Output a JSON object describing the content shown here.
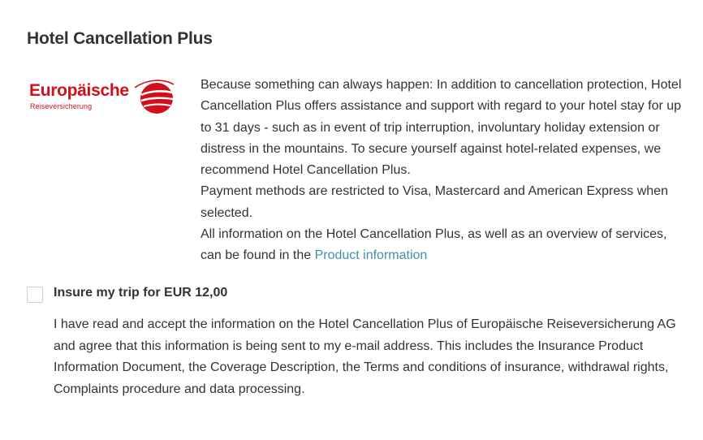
{
  "section": {
    "title": "Hotel Cancellation Plus"
  },
  "logo": {
    "brand": "Europäische",
    "sub": "Reiseversicherung",
    "color": "#d0111b",
    "icon": "globe-ball-icon"
  },
  "description": {
    "para1": "Because something can always happen: In addition to cancellation protection, Hotel Cancellation Plus offers assistance and support with regard to your hotel stay for up to 31 days - such as in event of trip interruption, involuntary holiday extension or distress in the mountains. To secure yourself against hotel-related expenses, we recommend Hotel Cancellation Plus.",
    "para2": "Payment methods are restricted to Visa, Mastercard and American Express when selected.",
    "para3_prefix": "All information on the Hotel Cancellation Plus, as well as an overview of services, can be found in the ",
    "product_link": "Product information",
    "link_color": "#3b93a8"
  },
  "insure": {
    "label": "Insure my trip for EUR 12,00",
    "checked": false
  },
  "consent": {
    "text": "I have read and accept the information on the Hotel Cancellation Plus of Europäische Reiseversicherung AG and agree that this information is being sent to my e-mail address. This includes the Insurance Product Information Document, the Coverage Description, the Terms and conditions of insurance, withdrawal rights, Complaints procedure and data processing."
  }
}
